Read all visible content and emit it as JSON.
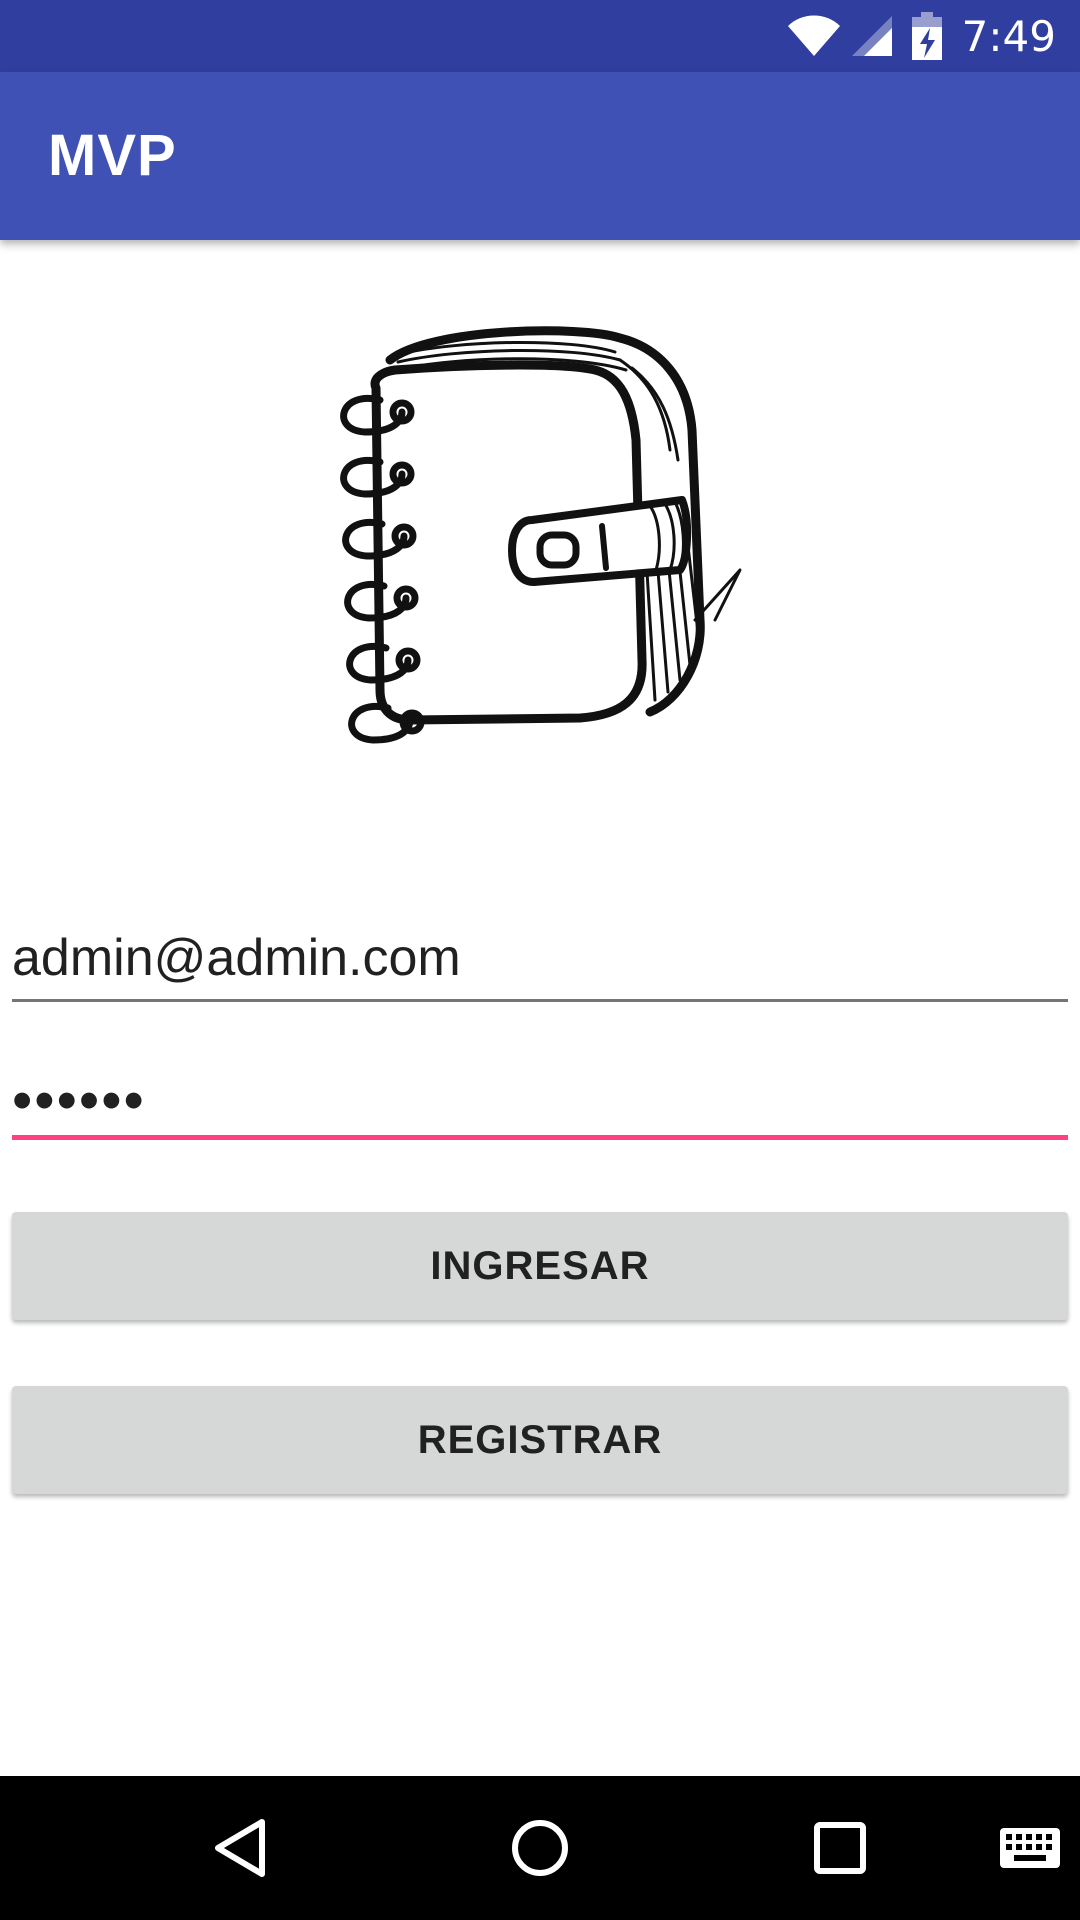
{
  "status_bar": {
    "time": "7:49",
    "icons": [
      "wifi-icon",
      "cell-signal-icon",
      "battery-charging-icon"
    ]
  },
  "app_bar": {
    "title": "MVP"
  },
  "logo": {
    "icon": "notebook-icon"
  },
  "form": {
    "email": {
      "value": "admin@admin.com"
    },
    "password": {
      "value": "••••••"
    }
  },
  "buttons": {
    "ingresar": "INGRESAR",
    "registrar": "REGISTRAR"
  },
  "nav_bar": {
    "icons": [
      "back-icon",
      "home-icon",
      "recents-icon",
      "keyboard-icon"
    ]
  },
  "colors": {
    "primary": "#3F51B5",
    "primary_dark": "#303F9F",
    "accent": "#FF4081",
    "button": "#D6D7D7"
  }
}
